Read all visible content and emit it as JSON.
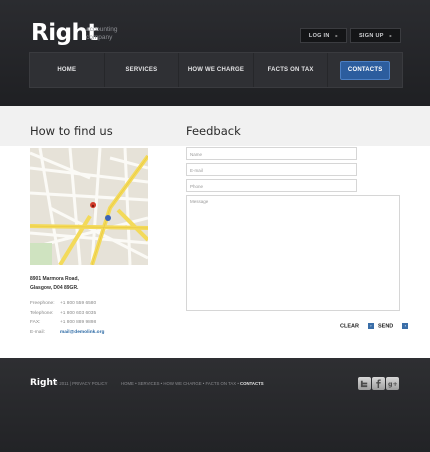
{
  "brand": {
    "name": "Right",
    "tagline_line1": "accounting",
    "tagline_line2": "company"
  },
  "top_buttons": [
    {
      "label": "LOG IN"
    },
    {
      "label": "SIGN UP"
    }
  ],
  "nav": [
    {
      "label": "HOME"
    },
    {
      "label": "SERVICES"
    },
    {
      "label": "HOW WE CHARGE"
    },
    {
      "label": "FACTS ON TAX"
    },
    {
      "label": "CONTACTS",
      "active": true
    }
  ],
  "find_us": {
    "title": "How to find us",
    "address_line1": "8901 Marmora Road,",
    "address_line2": "Glasgow, D04 89GR.",
    "rows": [
      {
        "label": "Freephone:",
        "value": "+1 800 559 6580"
      },
      {
        "label": "Telephone:",
        "value": "+1 800 603 6035"
      },
      {
        "label": "FAX:",
        "value": "+1 800 889 9898"
      },
      {
        "label": "E-mail:",
        "value": "mail@demolink.org"
      }
    ]
  },
  "feedback": {
    "title": "Feedback",
    "name_placeholder": "Name",
    "email_placeholder": "E-mail",
    "phone_placeholder": "Phone",
    "message_placeholder": "Message",
    "clear_label": "CLEAR",
    "send_label": "SEND"
  },
  "footer": {
    "logo": "Right",
    "copyright": "© 2011 | PRIVACY POLICY",
    "links": [
      "HOME",
      "SERVICES",
      "HOW WE CHARGE",
      "FACTS ON TAX",
      "CONTACTS"
    ],
    "social": [
      "twitter-icon",
      "facebook-icon",
      "google-plus-icon"
    ]
  },
  "colors": {
    "accent": "#2c5d9e",
    "link": "#2c6aa5"
  }
}
